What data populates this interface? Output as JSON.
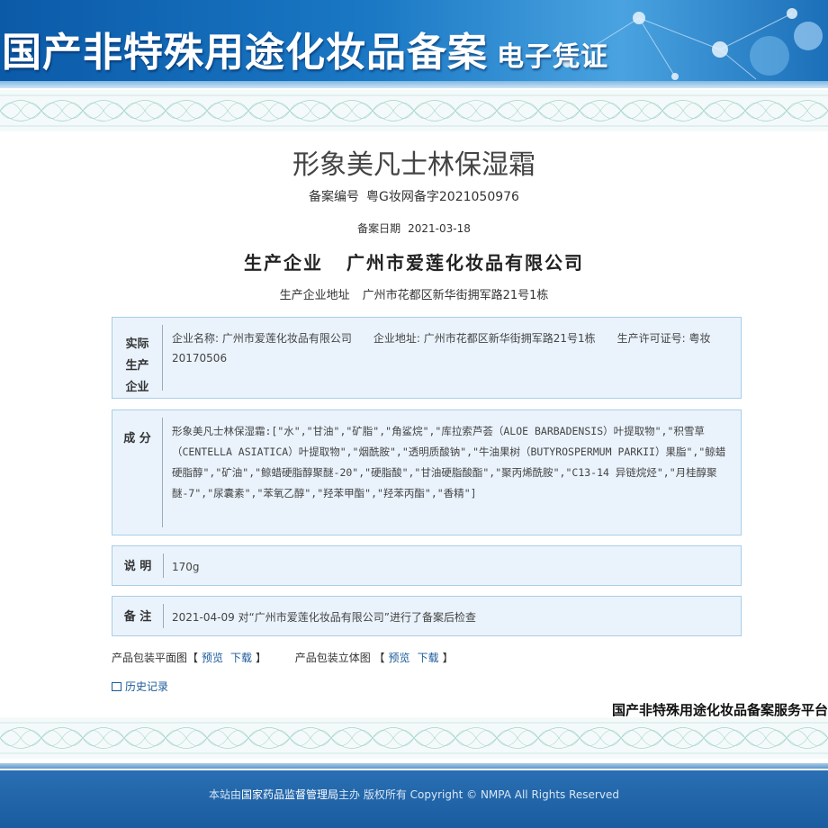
{
  "banner": {
    "title": "国产非特殊用途化妆品备案",
    "subtitle": "电子凭证"
  },
  "record": {
    "product_name": "形象美凡士林保湿霜",
    "filing_no_label": "备案编号",
    "filing_no": "粤G妆网备字2021050976",
    "filing_date_label": "备案日期",
    "filing_date": "2021-03-18",
    "producer_label": "生产企业",
    "producer": "广州市爱莲化妆品有限公司",
    "producer_addr_label": "生产企业地址",
    "producer_addr": "广州市花都区新华街拥军路21号1栋"
  },
  "actual_producer": {
    "head": [
      "实际",
      "生产",
      "企业"
    ],
    "text": "企业名称: 广州市爱莲化妆品有限公司　　企业地址: 广州市花都区新华街拥军路21号1栋　　生产许可证号: 粤妆20170506"
  },
  "ingredients": {
    "head": "成 分",
    "text": "形象美凡士林保湿霜:[\"水\",\"甘油\",\"矿脂\",\"角鲨烷\",\"库拉索芦荟（ALOE BARBADENSIS）叶提取物\",\"积雪草（CENTELLA ASIATICA）叶提取物\",\"烟酰胺\",\"透明质酸钠\",\"牛油果树（BUTYROSPERMUM PARKII）果脂\",\"鲸蜡硬脂醇\",\"矿油\",\"鲸蜡硬脂醇聚醚-20\",\"硬脂酸\",\"甘油硬脂酸酯\",\"聚丙烯酰胺\",\"C13-14 异链烷烃\",\"月桂醇聚醚-7\",\"尿囊素\",\"苯氧乙醇\",\"羟苯甲酯\",\"羟苯丙酯\",\"香精\"]"
  },
  "description": {
    "head": "说 明",
    "text": "170g"
  },
  "remarks": {
    "head": "备 注",
    "text": "2021-04-09 对“广州市爱莲化妆品有限公司”进行了备案后检查"
  },
  "downloads": {
    "flat_label": "产品包装平面图【",
    "flat_preview": "预览",
    "flat_download": "下载",
    "flat_close": "】",
    "stereo_label": "产品包装立体图 【",
    "stereo_preview": "预览",
    "stereo_download": "下载",
    "stereo_close": "】"
  },
  "history_link": "历史记录",
  "platform_label": "国产非特殊用途化妆品备案服务平台",
  "footer": {
    "prefix": "本站由",
    "org": "国家药品监督管理局",
    "suffix": "主办 版权所有 Copyright © NMPA All Rights Reserved"
  },
  "colors": {
    "banner_blue": "#1a78c4",
    "box_bg": "#eaf3fc",
    "box_border": "#a8cde8",
    "link": "#1a5a9a",
    "footer_blue": "#1a5c9f"
  }
}
